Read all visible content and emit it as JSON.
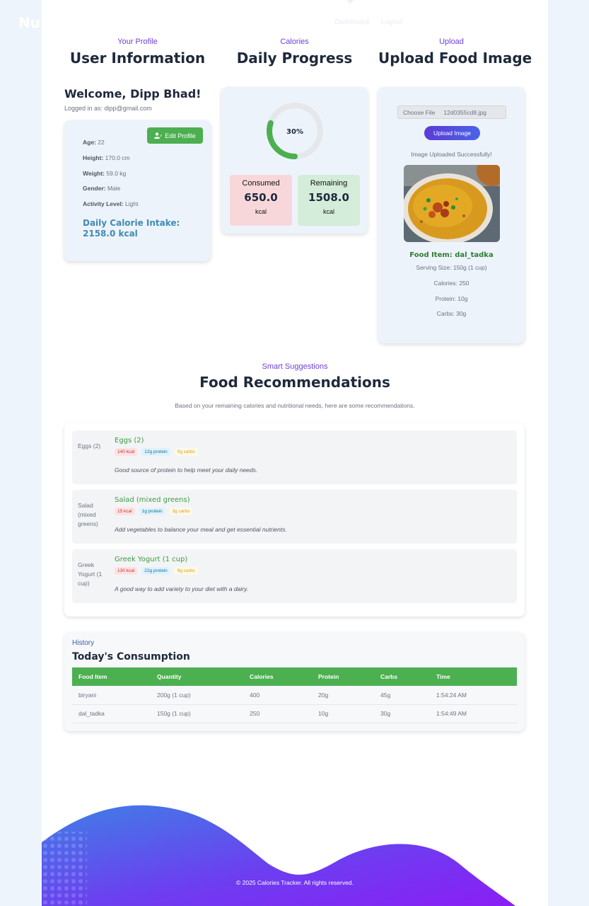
{
  "brand": "Nu",
  "nav": {
    "dashboard": "Dashboard",
    "logout": "Logout"
  },
  "profile": {
    "subtitle": "Your Profile",
    "title": "User Information",
    "welcome": "Welcome, Dipp Bhad!",
    "logged_in": "Logged in as: dipp@gmail.com",
    "edit_label": "Edit Profile",
    "rows": [
      {
        "label": "Age:",
        "value": "22"
      },
      {
        "label": "Height:",
        "value": "170.0 cm"
      },
      {
        "label": "Weight:",
        "value": "59.0 kg"
      },
      {
        "label": "Gender:",
        "value": "Male"
      },
      {
        "label": "Activity Level:",
        "value": "Light"
      }
    ],
    "daily_line1": "Daily Calorie Intake:",
    "daily_line2": "2158.0 kcal"
  },
  "progress": {
    "subtitle": "Calories",
    "title": "Daily Progress",
    "percent_label": "30%",
    "percent": 0.3,
    "consumed_label": "Consumed",
    "consumed_value": "650.0",
    "remaining_label": "Remaining",
    "remaining_value": "1508.0",
    "unit": "kcal",
    "colors": {
      "ring": "#4caf50",
      "ring_track": "#e5e7eb",
      "consumed_bg": "#f8d7da",
      "remaining_bg": "#d4edda"
    }
  },
  "upload": {
    "subtitle": "Upload",
    "title": "Upload Food Image",
    "choose_file": "Choose File",
    "file_name": "12d0355cd8.jpg",
    "button": "Upload Image",
    "message": "Image Uploaded Successfully!",
    "food_item": "Food Item: dal_tadka",
    "serving": "Serving Size: 150g (1 cup)",
    "calories": "Calories: 250",
    "protein": "Protein: 10g",
    "carbs": "Carbs: 30g"
  },
  "recommendations": {
    "subtitle": "Smart Suggestions",
    "title": "Food Recommendations",
    "intro": "Based on your remaining calories and nutritional needs, here are some recommendations.",
    "items": [
      {
        "alt": "Eggs (2)",
        "name": "Eggs (2)",
        "kcal": "140 kcal",
        "protein": "12g protein",
        "carbs": "0g carbs",
        "desc": "Good source of protein to help meet your daily needs."
      },
      {
        "alt": "Salad (mixed greens)",
        "name": "Salad (mixed greens)",
        "kcal": "15 kcal",
        "protein": "1g protein",
        "carbs": "3g carbs",
        "desc": "Add vegetables to balance your meal and get essential nutrients."
      },
      {
        "alt": "Greek Yogurt (1 cup)",
        "name": "Greek Yogurt (1 cup)",
        "kcal": "130 kcal",
        "protein": "22g protein",
        "carbs": "9g carbs",
        "desc": "A good way to add variety to your diet with a dairy."
      }
    ]
  },
  "history": {
    "subtitle": "History",
    "title": "Today's Consumption",
    "columns": [
      "Food Item",
      "Quantity",
      "Calories",
      "Protein",
      "Carbs",
      "Time"
    ],
    "rows": [
      [
        "biryani",
        "200g (1 cup)",
        "400",
        "20g",
        "45g",
        "1:54:24 AM"
      ],
      [
        "dal_tadka",
        "150g (1 cup)",
        "250",
        "10g",
        "30g",
        "1:54:49 AM"
      ]
    ]
  },
  "footer": "© 2025 Calories Tracker. All rights reserved."
}
